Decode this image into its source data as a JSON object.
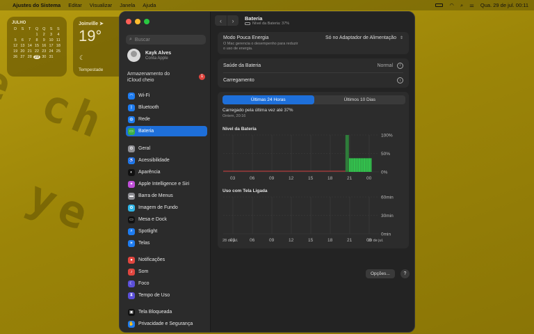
{
  "menubar": {
    "app": "Ajustes do Sistema",
    "menus": [
      "Editar",
      "Visualizar",
      "Janela",
      "Ajuda"
    ],
    "datetime": "Qua. 29 de jul.  00:11"
  },
  "calendar_widget": {
    "month": "JULHO",
    "weekdays": [
      "D",
      "S",
      "T",
      "Q",
      "Q",
      "S",
      "S"
    ],
    "days": [
      "",
      "",
      "",
      "1",
      "2",
      "3",
      "4",
      "5",
      "6",
      "7",
      "8",
      "9",
      "10",
      "11",
      "12",
      "13",
      "14",
      "15",
      "16",
      "17",
      "18",
      "19",
      "20",
      "21",
      "22",
      "23",
      "24",
      "25",
      "26",
      "27",
      "28",
      "29",
      "30",
      "31",
      ""
    ],
    "today": "29"
  },
  "weather_widget": {
    "city": "Joinville",
    "temp": "19°",
    "condition": "Tempestade"
  },
  "sidebar": {
    "search_placeholder": "Buscar",
    "user_name": "Kayk Alves",
    "user_sub": "Conta Apple",
    "icloud_line1": "Armazenamento do",
    "icloud_line2": "iCloud cheio",
    "icloud_badge": "1",
    "items": [
      {
        "label": "Wi-Fi",
        "color": "#1e7cf0",
        "icon": "wifi-icon"
      },
      {
        "label": "Bluetooth",
        "color": "#1e7cf0",
        "icon": "bluetooth-icon"
      },
      {
        "label": "Rede",
        "color": "#1e7cf0",
        "icon": "globe-icon"
      },
      {
        "label": "Bateria",
        "color": "#3cb043",
        "icon": "battery-icon"
      },
      {
        "label": "Geral",
        "color": "#8e8e93",
        "icon": "gear-icon"
      },
      {
        "label": "Acessibilidade",
        "color": "#1e7cf0",
        "icon": "accessibility-icon"
      },
      {
        "label": "Aparência",
        "color": "#111111",
        "icon": "appearance-icon"
      },
      {
        "label": "Apple Intelligence e Siri",
        "color": "#c04fd8",
        "icon": "siri-icon"
      },
      {
        "label": "Barra de Menus",
        "color": "#8e8e93",
        "icon": "menubar-icon"
      },
      {
        "label": "Imagem de Fundo",
        "color": "#2fb5e6",
        "icon": "wallpaper-icon"
      },
      {
        "label": "Mesa e Dock",
        "color": "#111111",
        "icon": "dock-icon"
      },
      {
        "label": "Spotlight",
        "color": "#1e7cf0",
        "icon": "spotlight-icon"
      },
      {
        "label": "Telas",
        "color": "#1e7cf0",
        "icon": "display-icon"
      },
      {
        "label": "Notificações",
        "color": "#e0463f",
        "icon": "notification-icon"
      },
      {
        "label": "Som",
        "color": "#e0463f",
        "icon": "sound-icon"
      },
      {
        "label": "Foco",
        "color": "#5b4fd8",
        "icon": "focus-icon"
      },
      {
        "label": "Tempo de Uso",
        "color": "#5b4fd8",
        "icon": "hourglass-icon"
      },
      {
        "label": "Tela Bloqueada",
        "color": "#111111",
        "icon": "lock-icon"
      },
      {
        "label": "Privacidade e Segurança",
        "color": "#1e7cf0",
        "icon": "hand-icon"
      }
    ]
  },
  "main": {
    "title": "Bateria",
    "subtitle": "Nível da Bateria: 37%",
    "low_power_label": "Modo Pouca Energia",
    "low_power_desc_line1": "O Mac gerencia o desempenho para reduzir",
    "low_power_desc_line2": "o uso de energia.",
    "low_power_value": "Só no Adaptador de Alimentação",
    "health_label": "Saúde da Bateria",
    "health_value": "Normal",
    "charging_label": "Carregamento",
    "tabs": [
      "Últimas 24 Horas",
      "Últimos 10 Dias"
    ],
    "charged_text": "Carregado pela última vez até 37%",
    "charged_time": "Ontem, 20:16",
    "battery_chart_title": "Nível da Bateria",
    "screen_chart_title": "Uso com Tela Ligada",
    "date_left": "28 de jul.",
    "date_right": "29 de jul.",
    "options_button": "Opções...",
    "help_button": "?"
  },
  "chart_data": [
    {
      "type": "bar",
      "title": "Nível da Bateria",
      "x_ticks": [
        "03",
        "06",
        "09",
        "12",
        "15",
        "18",
        "21",
        "00"
      ],
      "y_ticks": [
        "100%",
        "50%",
        "0%"
      ],
      "ylim": [
        0,
        100
      ],
      "series": [
        {
          "name": "",
          "values": [
            {
              "x": 20.6,
              "y": 100
            },
            {
              "x": 21.0,
              "y": 37
            },
            {
              "x": 21.25,
              "y": 37
            },
            {
              "x": 21.5,
              "y": 37
            },
            {
              "x": 21.75,
              "y": 37
            },
            {
              "x": 22.0,
              "y": 37
            },
            {
              "x": 22.25,
              "y": 37
            },
            {
              "x": 22.5,
              "y": 37
            },
            {
              "x": 22.75,
              "y": 37
            },
            {
              "x": 23.0,
              "y": 37
            },
            {
              "x": 23.25,
              "y": 37
            },
            {
              "x": 23.5,
              "y": 37
            },
            {
              "x": 23.75,
              "y": 37
            },
            {
              "x": 24.0,
              "y": 37
            },
            {
              "x": 24.25,
              "y": 37
            }
          ]
        }
      ]
    },
    {
      "type": "bar",
      "title": "Uso com Tela Ligada",
      "x_ticks": [
        "03",
        "06",
        "09",
        "12",
        "15",
        "18",
        "21",
        "00"
      ],
      "y_ticks": [
        "60min",
        "30min",
        "0min"
      ],
      "ylim": [
        0,
        60
      ],
      "series": []
    }
  ]
}
